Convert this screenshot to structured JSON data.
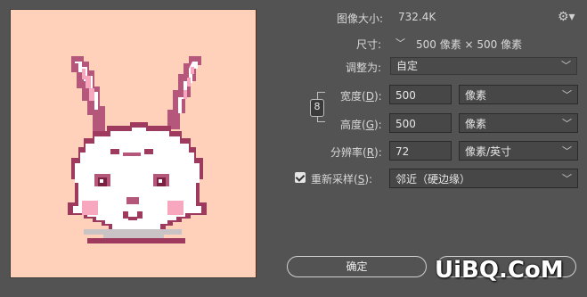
{
  "image_size": {
    "label": "图像大小:",
    "value": "732.4K"
  },
  "dimensions": {
    "label": "尺寸:",
    "value": "500 像素  ×  500 像素"
  },
  "fit_to": {
    "label": "调整为:",
    "value": "自定"
  },
  "width": {
    "label": "宽度(",
    "key": "D",
    "suffix": "):",
    "value": "500",
    "unit": "像素"
  },
  "height": {
    "label": "高度(",
    "key": "G",
    "suffix": "):",
    "value": "500",
    "unit": "像素"
  },
  "resolution": {
    "label": "分辨率(",
    "key": "R",
    "suffix": "):",
    "value": "72",
    "unit": "像素/英寸"
  },
  "resample": {
    "label": "重新采样(",
    "key": "S",
    "suffix": "):",
    "checked": true,
    "value": "邻近（硬边缘）"
  },
  "buttons": {
    "ok": "确定"
  },
  "watermark": "UiBQ.CoM",
  "colors": {
    "preview_bg": "#ffd1ba",
    "panel_bg": "#535353"
  }
}
